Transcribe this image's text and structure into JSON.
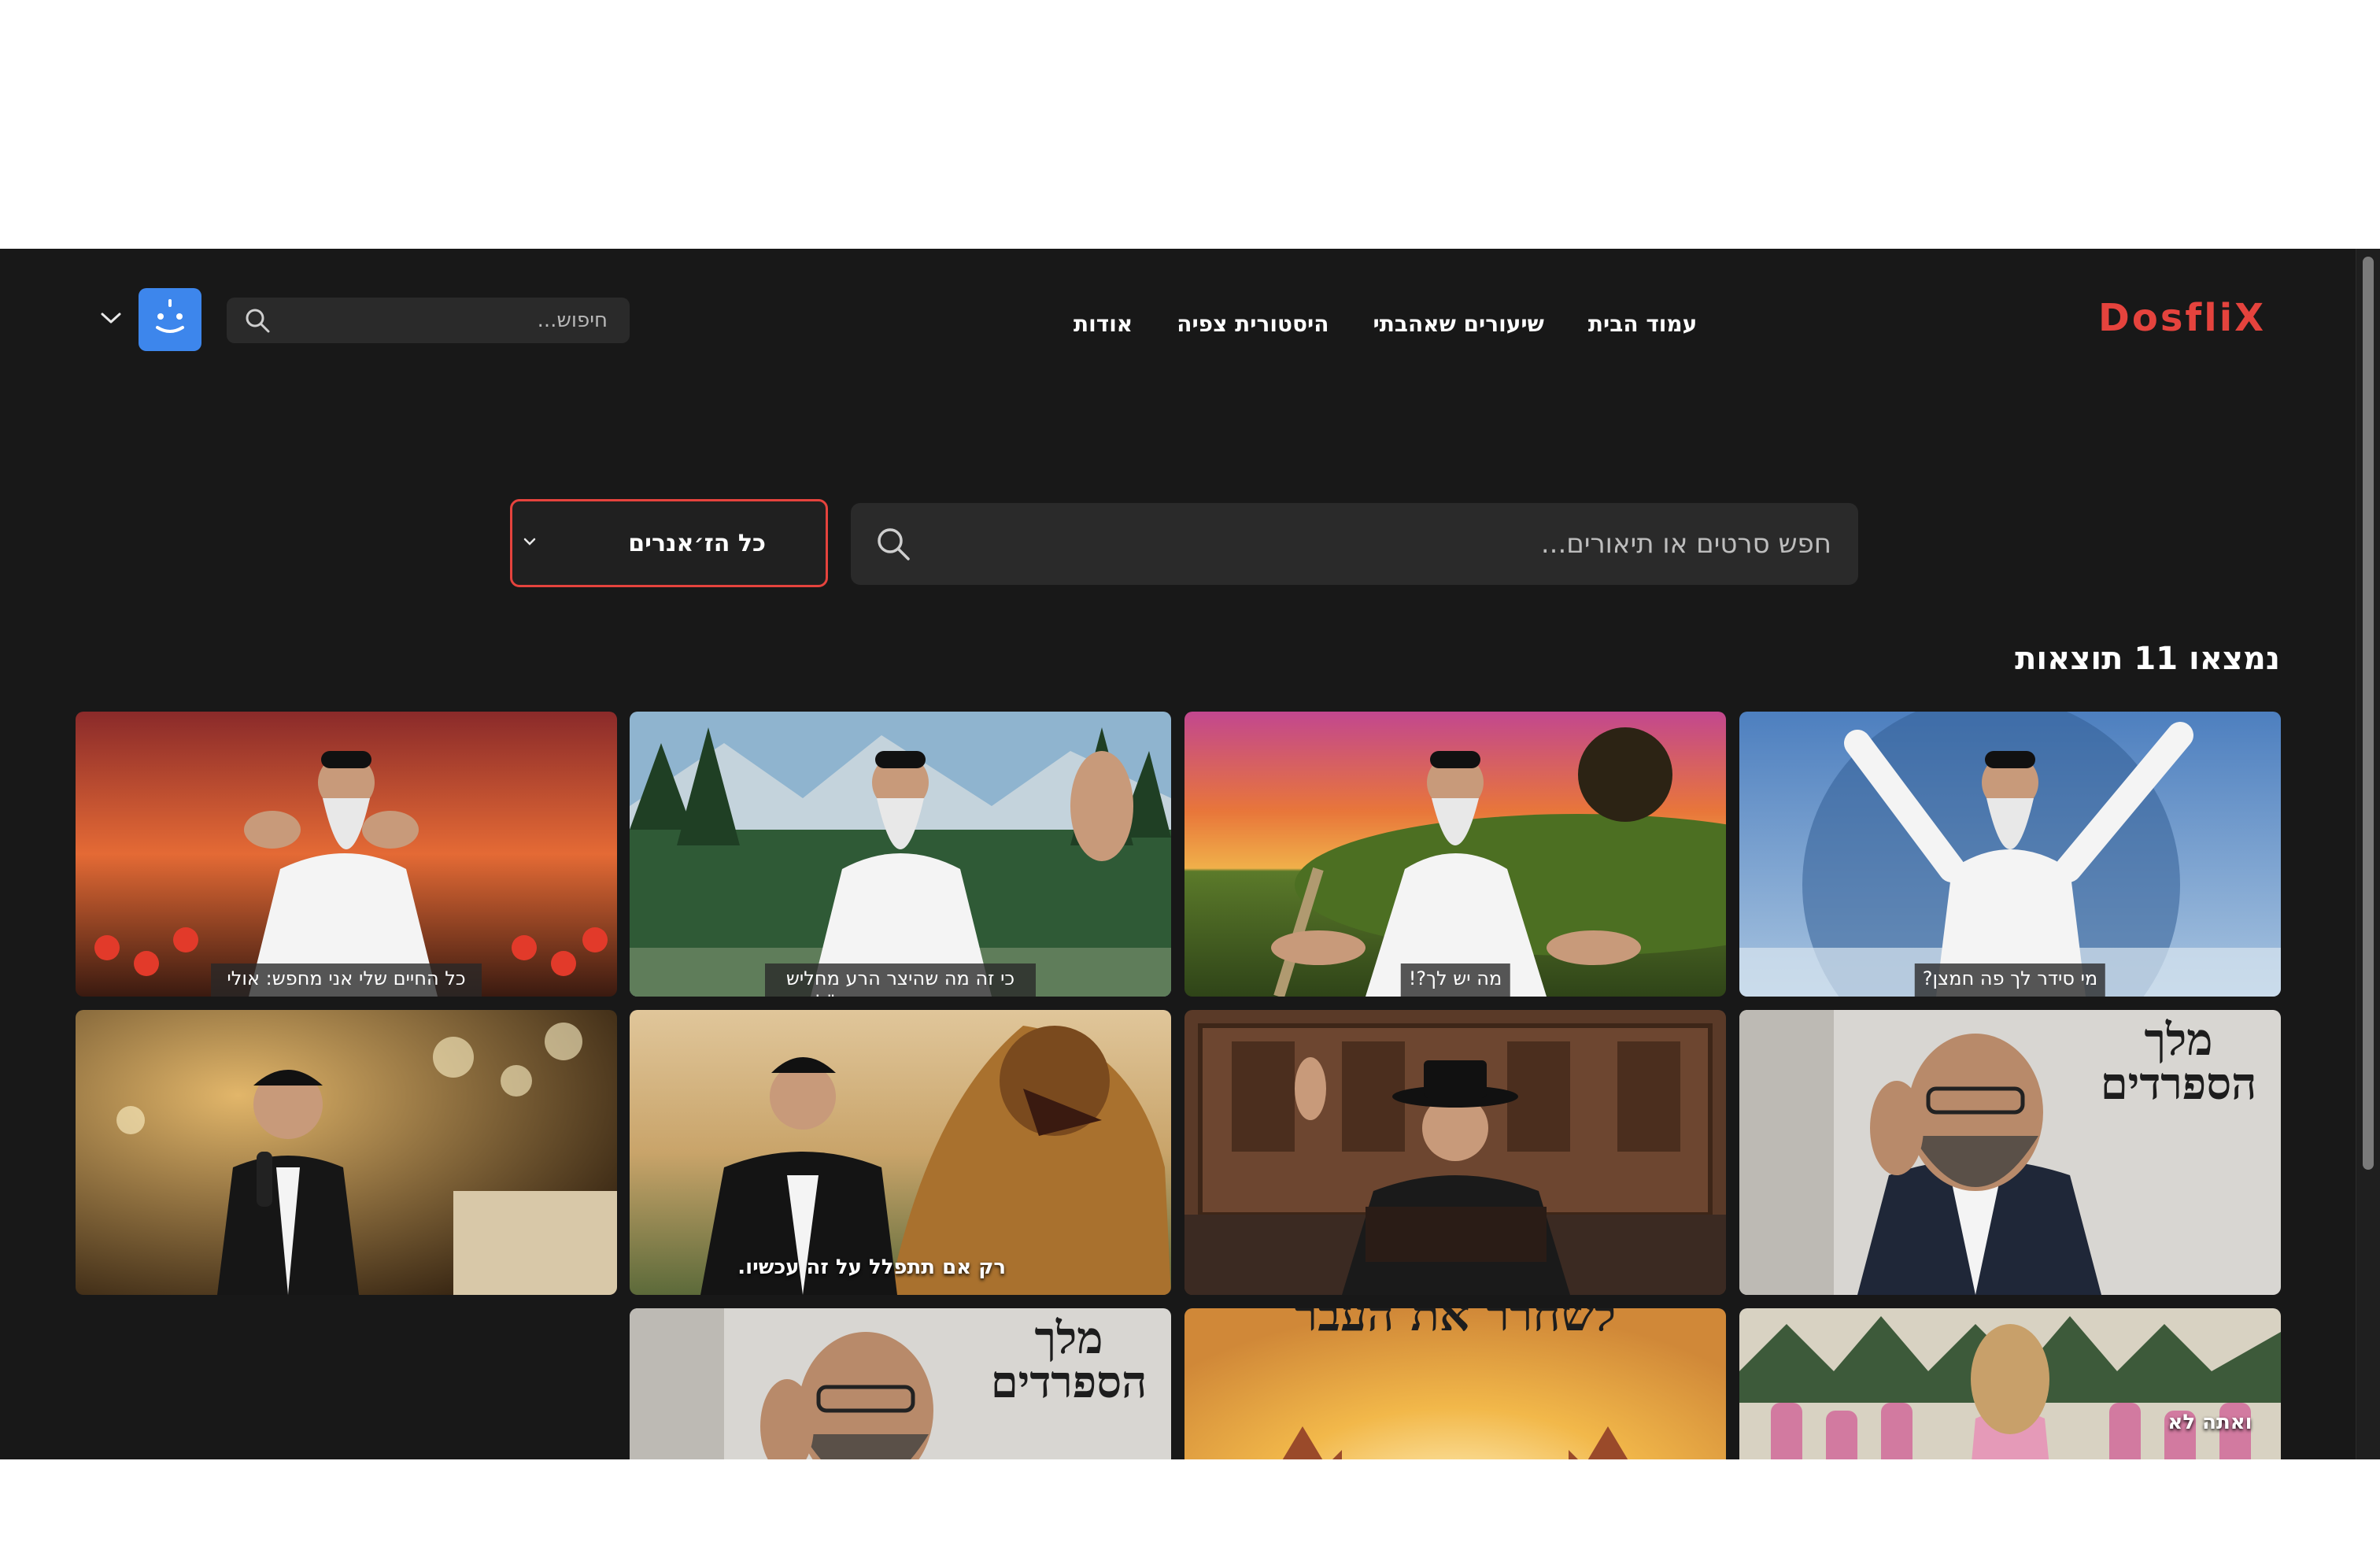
{
  "header": {
    "logo": "DosfliX",
    "nav": [
      {
        "label": "עמוד הבית"
      },
      {
        "label": "שיעורים שאהבתי"
      },
      {
        "label": "היסטורית צפיה"
      },
      {
        "label": "אודות"
      }
    ],
    "search_placeholder": "חיפוש..."
  },
  "filters": {
    "genre_selected": "כל הז׳אנרים",
    "search_placeholder": "חפש סרטים או תיאורים..."
  },
  "results": {
    "count_text": "נמצאו 11 תוצאות",
    "items": [
      {
        "caption": "מי סידר לך פה חמצן?"
      },
      {
        "caption": "מה יש לך?!"
      },
      {
        "caption": "כי זה מה שהיצר הרע מחליש אותה. זה מה שנקרא: \"לנצח את הרע\""
      },
      {
        "caption": "כל החיים שלי אני מחפש: אולי זה יעשה אותי מאושר"
      },
      {
        "poster_title": "מלך הספרדים"
      },
      {
        "caption": ""
      },
      {
        "overlay": "רק אם תתפלל על זה עכשיו."
      },
      {
        "caption": ""
      },
      {
        "overlay": "ואתה לא"
      },
      {
        "banner": "לשחרר את העבר"
      },
      {
        "poster_title": "מלך הספרדים"
      }
    ]
  },
  "colors": {
    "background": "#181818",
    "accent": "#e5433d",
    "avatar": "#3d86ec"
  },
  "icons": [
    "search-icon",
    "chevron-down-icon",
    "avatar-face-icon"
  ]
}
